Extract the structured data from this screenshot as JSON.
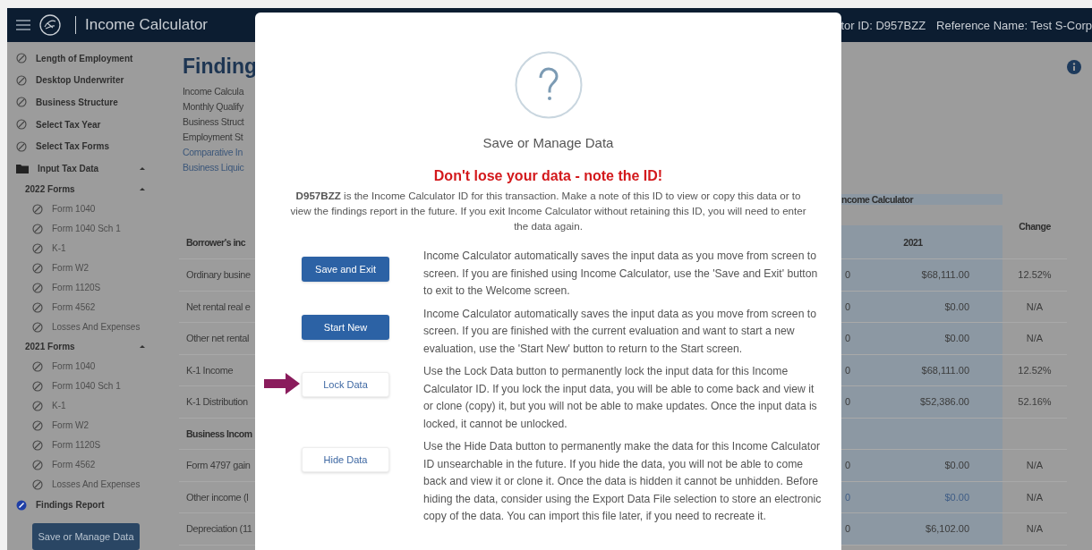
{
  "header": {
    "title": "Income Calculator",
    "id_text": "tor ID: D957BZZ",
    "reference_text": "Reference Name: Test S-Corp"
  },
  "sidebar": {
    "items": [
      {
        "label": "Length of Employment",
        "kind": "step",
        "selected": false
      },
      {
        "label": "Desktop Underwriter",
        "kind": "step",
        "selected": false
      },
      {
        "label": "Business Structure",
        "kind": "step",
        "selected": false
      },
      {
        "label": "Select Tax Year",
        "kind": "step",
        "selected": false
      },
      {
        "label": "Select Tax Forms",
        "kind": "step",
        "selected": false
      },
      {
        "label": "Input Tax Data",
        "kind": "folder",
        "expanded": true,
        "children": [
          {
            "label": "2022 Forms",
            "kind": "group",
            "expanded": true,
            "children": [
              {
                "label": "Form 1040",
                "kind": "form",
                "selected": false
              },
              {
                "label": "Form 1040 Sch 1",
                "kind": "form",
                "selected": false
              },
              {
                "label": "K-1",
                "kind": "form",
                "selected": false
              },
              {
                "label": "Form W2",
                "kind": "form",
                "selected": false
              },
              {
                "label": "Form 1120S",
                "kind": "form",
                "selected": false
              },
              {
                "label": "Form 4562",
                "kind": "form",
                "selected": false
              },
              {
                "label": "Losses And Expenses",
                "kind": "form",
                "selected": false
              }
            ]
          },
          {
            "label": "2021 Forms",
            "kind": "group",
            "expanded": true,
            "children": [
              {
                "label": "Form 1040",
                "kind": "form",
                "selected": false
              },
              {
                "label": "Form 1040 Sch 1",
                "kind": "form",
                "selected": false
              },
              {
                "label": "K-1",
                "kind": "form",
                "selected": false
              },
              {
                "label": "Form W2",
                "kind": "form",
                "selected": false
              },
              {
                "label": "Form 1120S",
                "kind": "form",
                "selected": false
              },
              {
                "label": "Form 4562",
                "kind": "form",
                "selected": false
              },
              {
                "label": "Losses And Expenses",
                "kind": "form",
                "selected": false
              }
            ]
          }
        ]
      },
      {
        "label": "Findings Report",
        "kind": "step",
        "selected": true
      }
    ],
    "button": "Save or Manage Data"
  },
  "main": {
    "heading": "Finding",
    "summary": [
      {
        "text": "Income Calcula",
        "link": false
      },
      {
        "text": "Monthly Qualify",
        "link": false
      },
      {
        "text": "Business Struct",
        "link": false
      },
      {
        "text": "Employment St",
        "link": false
      },
      {
        "text": "Comparative In",
        "link": true
      },
      {
        "text": "Business Liquic",
        "link": true
      }
    ]
  },
  "table": {
    "group_heading": "ncome Calculator",
    "columns": [
      "Borrower's inc",
      "2021",
      "Change"
    ],
    "rows": [
      {
        "kind": "data",
        "label": "Ordinary busine",
        "column_2": "0",
        "value": "$68,111.00",
        "change": "12.52%",
        "link": false
      },
      {
        "kind": "data",
        "label": "Net rental real e",
        "column_2": "0",
        "value": "$0.00",
        "change": "N/A",
        "link": false
      },
      {
        "kind": "data",
        "label": "Other net rental",
        "column_2": "0",
        "value": "$0.00",
        "change": "N/A",
        "link": false
      },
      {
        "kind": "data",
        "label": "K-1 Income",
        "column_2": "0",
        "value": "$68,111.00",
        "change": "12.52%",
        "link": false
      },
      {
        "kind": "data",
        "label": "K-1 Distribution",
        "column_2": "0",
        "value": "$52,386.00",
        "change": "52.16%",
        "link": false
      },
      {
        "kind": "section",
        "label": "Business Incom"
      },
      {
        "kind": "data",
        "label": "Form 4797 gain",
        "column_2": "0",
        "value": "$0.00",
        "change": "N/A",
        "link": false
      },
      {
        "kind": "data",
        "label": "Other income (l",
        "column_2": "0",
        "value": "$0.00",
        "change": "N/A",
        "link": true
      },
      {
        "kind": "data",
        "label": "Depreciation (11",
        "column_2": "0",
        "value": "$6,102.00",
        "change": "N/A",
        "link": false
      }
    ]
  },
  "dialog": {
    "title": "Save or Manage Data",
    "warning": "Don't lose your data - note the ID!",
    "message": "**D957BZZ** is the Income Calculator ID for this transaction. Make a note of this ID to view or copy this data or to view the findings report in the future. If you exit Income Calculator without retaining this ID, you will need to enter the data again.",
    "actions": [
      {
        "label": "Save and Exit",
        "kind": "primary",
        "pointed": false,
        "description": "Income Calculator automatically saves the input data as you move from screen to screen. If you are finished using Income Calculator, use the 'Save and Exit' button to exit to the Welcome screen."
      },
      {
        "label": "Start New",
        "kind": "primary",
        "pointed": false,
        "description": "Income Calculator automatically saves the input data as you move from screen to screen. If you are finished with the current evaluation and want to start a new evaluation, use the 'Start New' button to return to the Start screen."
      },
      {
        "label": "Lock Data",
        "kind": "secondary",
        "pointed": true,
        "description": "Use the Lock Data button to permanently lock the input data for this Income Calculator ID. If you lock the input data, you will be able to come back and view it or clone (copy) it, but you will not be able to make updates. Once the input data is locked, it cannot be unlocked."
      },
      {
        "label": "Hide Data",
        "kind": "secondary",
        "pointed": false,
        "description": "Use the Hide Data button to permanently make the data for this Income Calculator ID unsearchable in the future. If you hide the data, you will not be able to come back and view it or clone it. Once the data is hidden it cannot be unhidden. Before hiding the data, consider using the Export Data File selection to store an electronic copy of the data. You can import this file later, if you need to recreate it."
      }
    ]
  }
}
